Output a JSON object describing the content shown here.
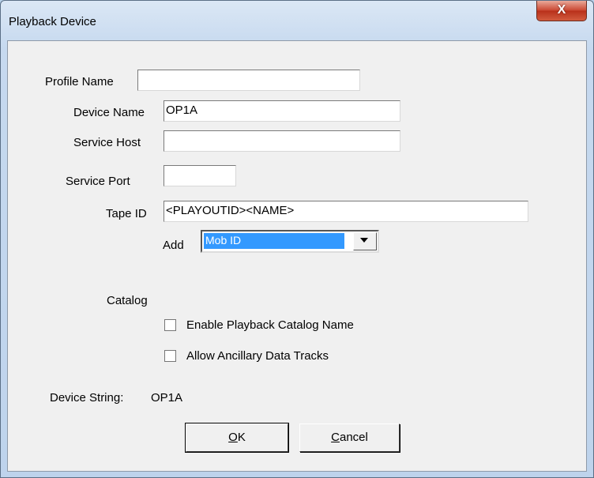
{
  "window": {
    "title": "Playback Device",
    "close_glyph": "X",
    "close_icon": "close-icon"
  },
  "form": {
    "profile_name": {
      "label": "Profile Name",
      "value": ""
    },
    "device_name": {
      "label": "Device Name",
      "value": "OP1A"
    },
    "service_host": {
      "label": "Service Host",
      "value": ""
    },
    "service_port": {
      "label": "Service Port",
      "value": ""
    },
    "tape_id": {
      "label": "Tape ID",
      "value": "<PLAYOUTID><NAME>"
    },
    "add": {
      "label": "Add",
      "selected": "Mob ID",
      "arrow_icon": "chevron-down-icon"
    }
  },
  "catalog": {
    "heading": "Catalog",
    "enable_playback_catalog_name": {
      "label": "Enable Playback Catalog Name",
      "checked": false
    },
    "allow_ancillary_data_tracks": {
      "label": "Allow Ancillary Data Tracks",
      "checked": false
    }
  },
  "device_string": {
    "label": "Device String:",
    "value": "OP1A"
  },
  "buttons": {
    "ok": {
      "accel": "O",
      "rest": "K"
    },
    "cancel": {
      "accel": "C",
      "rest": "ancel"
    }
  },
  "colors": {
    "selection": "#3399ff",
    "close_button": "#c9452f",
    "frame": "#c6d9ef"
  }
}
